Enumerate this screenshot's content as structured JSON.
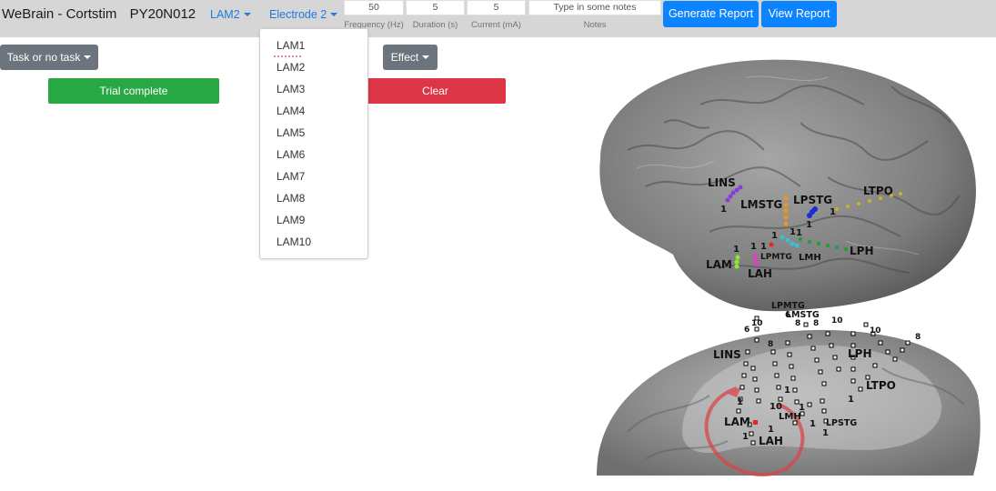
{
  "app": {
    "title": "WeBrain - Cortstim",
    "patient": "PY20N012"
  },
  "nav": {
    "electrode_dropdown": "LAM2",
    "electrode_number_dropdown": "Electrode 2"
  },
  "fields": {
    "frequency": {
      "value": "50",
      "label": "Frequency (Hz)"
    },
    "duration": {
      "value": "5",
      "label": "Duration (s)"
    },
    "current": {
      "value": "5",
      "label": "Current (mA)"
    },
    "notes": {
      "placeholder": "Type in some notes",
      "label": "Notes"
    }
  },
  "buttons": {
    "generate_report": "Generate Report",
    "view_report": "View Report",
    "task": "Task or no task",
    "effect": "Effect",
    "trial_complete": "Trial complete",
    "clear": "Clear"
  },
  "menu": {
    "items": [
      "LAM1",
      "LAM2",
      "LAM3",
      "LAM4",
      "LAM5",
      "LAM6",
      "LAM7",
      "LAM8",
      "LAM9",
      "LAM10"
    ]
  },
  "brain_labels": {
    "top": [
      "LINS",
      "LMSTG",
      "LPSTG",
      "LTPO",
      "LAM",
      "LAH",
      "LPMTG",
      "LMH",
      "LPH"
    ],
    "bottom": [
      "LPMTG",
      "LMSTG",
      "LINS",
      "LPH",
      "LTPO",
      "LAM",
      "LMH",
      "LPSTG",
      "LAH"
    ],
    "numbers": [
      "1",
      "6",
      "8",
      "10"
    ]
  },
  "colors": {
    "topbar": "#d6d6d6",
    "primary": "#0d84ff",
    "success": "#28a745",
    "danger": "#dc3545",
    "secondary": "#6c757d"
  }
}
